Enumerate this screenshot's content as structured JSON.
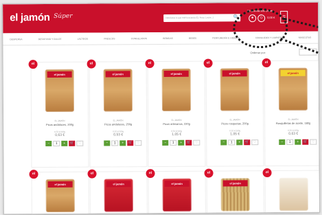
{
  "header": {
    "logo": "el jamón",
    "logo_script": "Súper",
    "search_placeholder": "Introduzca lo que esté buscando (Ej: Arroz, Leche...)",
    "search_icon": "search-icon",
    "user_links": "Mi Cuenta   Mis Listas",
    "cart_total": "0,00 €",
    "accent_color": "#c9102b"
  },
  "nav": {
    "items": [
      "DESPENSA",
      "DESAYUNO Y DULCE",
      "LÁCTEOS",
      "FRESCOS",
      "CONGELADOS",
      "BEBIDAS",
      "BEBÉS",
      "PERFUMERÍA E HIGIENE",
      "DROGUERÍA Y LIMPIEZA",
      "MASCOTAS"
    ]
  },
  "toolbar": {
    "label": "Ordenar por:",
    "sort_value": ""
  },
  "products": [
    {
      "badge": "el",
      "brand": "EL JAMÓN",
      "name": "Picos andaluces, 200g",
      "price_old": "0,53 €/100g",
      "price": "0,63 €",
      "bag_label": "el jamón",
      "bag_style": "red"
    },
    {
      "badge": "el",
      "brand": "EL JAMÓN",
      "name": "Picos andaluces, 250g",
      "price_old": "0,53 €/100g",
      "price": "0,53 €",
      "bag_label": "el jamón",
      "bag_style": "red"
    },
    {
      "badge": "el",
      "brand": "EL JAMÓN",
      "name": "Picos artesanos, 220g",
      "price_old": "0,53 €/100g",
      "price": "1,05 €",
      "bag_label": "el jamón",
      "bag_style": "red"
    },
    {
      "badge": "el",
      "brand": "EL JAMÓN",
      "name": "Picos rosquetas, 200g",
      "price_old": "0,53 €/100g",
      "price": "1,05 €",
      "bag_label": "el jamón",
      "bag_style": "red"
    },
    {
      "badge": "el",
      "brand": "EL JAMÓN",
      "name": "Rosquilletas de aceite, 180g",
      "price_old": "0,53 €/100g",
      "price": "0,63 €",
      "bag_label": "el jamón",
      "bag_style": "yellow"
    }
  ],
  "products_row2": [
    {
      "badge": "el",
      "bag_label": "el jamón",
      "bag_style": "red"
    },
    {
      "badge": "el",
      "bag_label": "el jamón",
      "bag_style": "redfull"
    },
    {
      "badge": "el",
      "bag_label": "el jamón",
      "bag_style": "redfull"
    },
    {
      "badge": "el",
      "bag_label": "el jamón",
      "bag_style": "sticks"
    },
    {
      "badge": "el",
      "bag_label": "",
      "bag_style": "clear"
    }
  ],
  "buy": {
    "minus": "−",
    "qty": "1",
    "plus": "+",
    "cart": "🛒",
    "fav": "♡"
  }
}
